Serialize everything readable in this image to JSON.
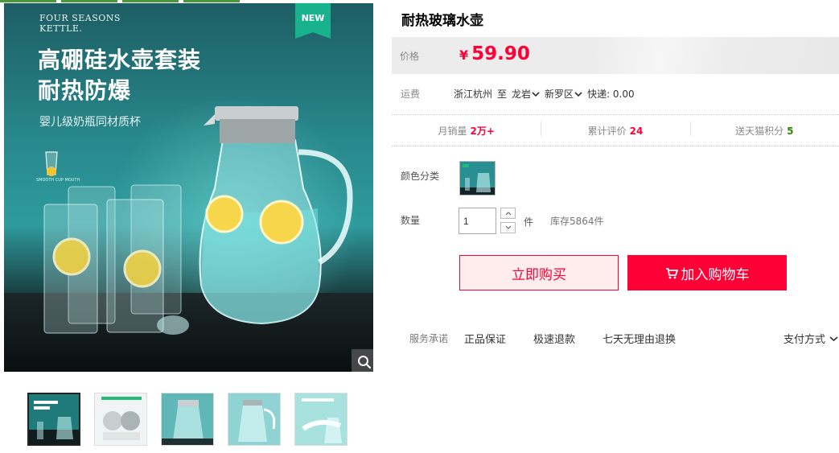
{
  "product": {
    "title": "耐热玻璃水壶",
    "badge": "NEW",
    "brand_line1": "FOUR SEASONS",
    "brand_line2": "KETTLE.",
    "headline_line1": "高硼硅水壶套装",
    "headline_line2": "耐热防爆",
    "subline": "婴儿级奶瓶同材质杯",
    "cup_caption": "SMOOTH CUP MOUTH"
  },
  "price": {
    "label": "价格",
    "currency": "¥",
    "value": "59.90"
  },
  "shipping": {
    "label": "运费",
    "from": "浙江杭州",
    "to_word": "至",
    "city": "龙岩",
    "district": "新罗区",
    "fee": "快递: 0.00"
  },
  "stats": {
    "monthly_sales_label": "月销量",
    "monthly_sales_value": "2万+",
    "reviews_label": "累计评价",
    "reviews_value": "24",
    "points_label": "送天猫积分",
    "points_value": "5"
  },
  "options": {
    "color_label": "颜色分类"
  },
  "quantity": {
    "label": "数量",
    "value": "1",
    "unit": "件",
    "stock": "库存5864件"
  },
  "actions": {
    "buy_now": "立即购买",
    "add_to_cart": "加入购物车"
  },
  "service": {
    "label": "服务承诺",
    "items": [
      "正品保证",
      "极速退款",
      "七天无理由退换"
    ],
    "payment": "支付方式"
  },
  "colors": {
    "accent": "#ff0036",
    "badge_green": "#18b28d",
    "points_green": "#2b8a00"
  },
  "icons": [
    "zoom-icon",
    "cart-icon",
    "chevron-down-icon",
    "arrow-up-icon",
    "arrow-down-icon"
  ]
}
